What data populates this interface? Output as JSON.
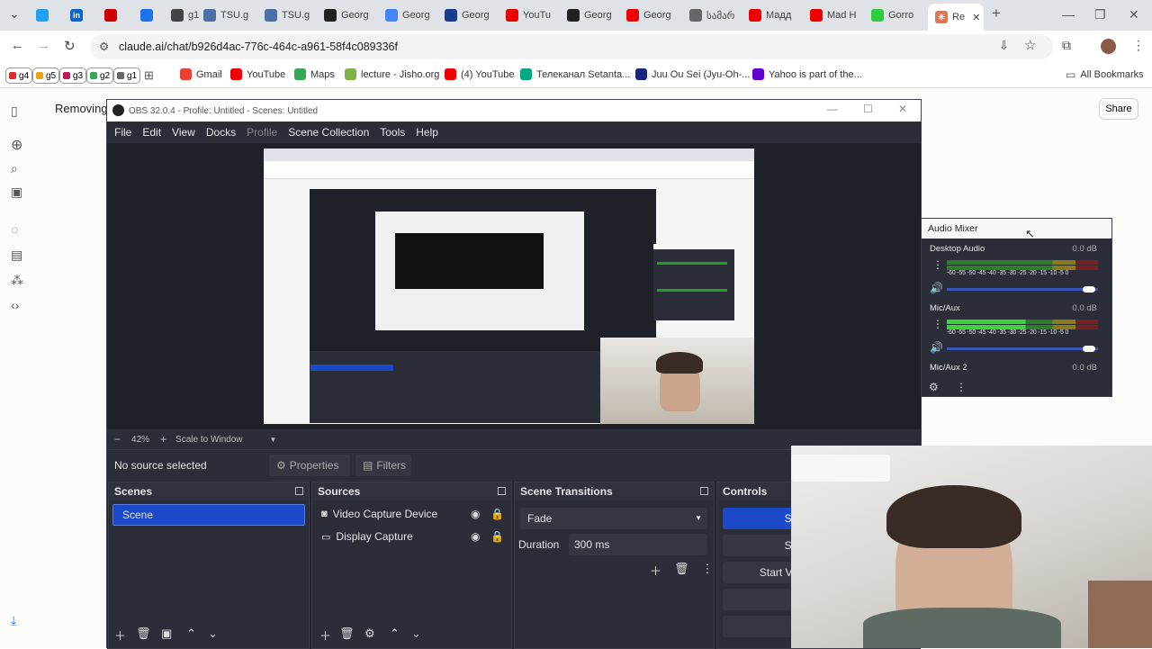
{
  "browser": {
    "tabs": [
      {
        "label": "",
        "color": "#1da1f2"
      },
      {
        "label": "",
        "color": "#0a66c2",
        "glyph": "in"
      },
      {
        "label": "",
        "color": "#cc0000"
      },
      {
        "label": "",
        "color": "#1a73e8"
      },
      {
        "label": "g1",
        "color": "#444"
      },
      {
        "label": "TSU.g",
        "color": "#4a6fa5"
      },
      {
        "label": "TSU.g",
        "color": "#4a6fa5"
      },
      {
        "label": "Georg",
        "color": "#222"
      },
      {
        "label": "Georg",
        "color": "#4285f4"
      },
      {
        "label": "Georg",
        "color": "#1a3c8c"
      },
      {
        "label": "YouTu",
        "color": "#e00"
      },
      {
        "label": "Georg",
        "color": "#222"
      },
      {
        "label": "Georg",
        "color": "#e00"
      },
      {
        "label": "სამარ",
        "color": "#666"
      },
      {
        "label": "Мадд",
        "color": "#e00"
      },
      {
        "label": "Mad H",
        "color": "#e00"
      },
      {
        "label": "Gorro",
        "color": "#2ecc40"
      }
    ],
    "active_tab": "Re",
    "url": "claude.ai/chat/b926d4ac-776c-464c-a961-58f4c089336f",
    "bookmarks_chips": [
      {
        "label": "g4",
        "color": "#d93025"
      },
      {
        "label": "g5",
        "color": "#e8a317"
      },
      {
        "label": "g3",
        "color": "#c2185b"
      },
      {
        "label": "g2",
        "color": "#34a853"
      },
      {
        "label": "g1",
        "color": "#666"
      }
    ],
    "bookmarks": [
      "Gmail",
      "YouTube",
      "Maps",
      "lecture - Jisho.org",
      "(4) YouTube",
      "Телеканал Setanta...",
      "Juu Ou Sei (Jyu-Oh-...",
      "Yahoo is part of the..."
    ],
    "all_bookmarks": "All Bookmarks"
  },
  "claude": {
    "title": "Removing",
    "share": "Share"
  },
  "obs": {
    "window_title": "OBS 32.0.4 - Profile: Untitled - Scenes: Untitled",
    "menu": [
      "File",
      "Edit",
      "View",
      "Docks",
      "Profile",
      "Scene Collection",
      "Tools",
      "Help"
    ],
    "zoom": "42%",
    "scale_mode": "Scale to Window",
    "no_source": "No source selected",
    "properties": "Properties",
    "filters": "Filters",
    "docks": {
      "scenes": {
        "title": "Scenes",
        "items": [
          "Scene"
        ]
      },
      "sources": {
        "title": "Sources",
        "items": [
          "Video Capture Device",
          "Display Capture"
        ]
      },
      "transitions": {
        "title": "Scene Transitions",
        "type": "Fade",
        "duration_label": "Duration",
        "duration": "300 ms"
      },
      "controls": {
        "title": "Controls",
        "buttons": [
          "St",
          "St",
          "Start Vi",
          "",
          "",
          ""
        ]
      }
    }
  },
  "audio_mixer": {
    "title": "Audio Mixer",
    "channels": [
      {
        "name": "Desktop Audio",
        "db": "0.0 dB"
      },
      {
        "name": "Mic/Aux",
        "db": "0.0 dB"
      },
      {
        "name": "Mic/Aux 2",
        "db": "0.0 dB"
      }
    ],
    "scale": "-60 -55 -50 -45 -40 -35 -30 -25 -20 -15 -10 -5 0"
  }
}
